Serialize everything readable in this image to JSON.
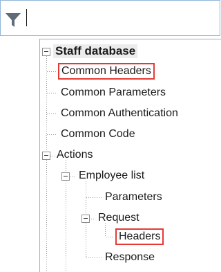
{
  "filter": {
    "icon": "filter-icon",
    "value": "",
    "placeholder": ""
  },
  "tree": {
    "root": {
      "label": "Staff database",
      "expanded": true
    },
    "common_headers": {
      "label": "Common Headers",
      "highlighted": true
    },
    "common_parameters": {
      "label": "Common Parameters"
    },
    "common_authentication": {
      "label": "Common Authentication"
    },
    "common_code": {
      "label": "Common Code"
    },
    "actions": {
      "label": "Actions",
      "expanded": true
    },
    "employee_list": {
      "label": "Employee list",
      "expanded": true
    },
    "parameters": {
      "label": "Parameters"
    },
    "request": {
      "label": "Request",
      "expanded": true
    },
    "headers": {
      "label": "Headers",
      "highlighted": true
    },
    "response": {
      "label": "Response"
    }
  },
  "colors": {
    "border": "#8fb4d9",
    "highlight": "#e53935",
    "tree_line": "#9a9a9a"
  }
}
